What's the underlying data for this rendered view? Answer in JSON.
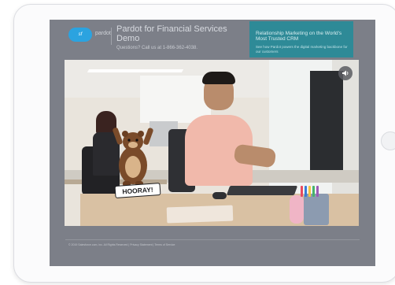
{
  "header": {
    "logo_text": "pardot",
    "title": "Pardot for Financial Services Demo",
    "subtitle": "Questions? Call us at 1-866-362-4038."
  },
  "promo": {
    "title": "Relationship Marketing on the World's Most Trusted CRM",
    "body": "See how Pardot powers the digital marketing backbone for our customers"
  },
  "video": {
    "sticker_text": "HOORAY!",
    "sound_icon": "speaker-icon"
  },
  "footer": {
    "text": "© 2019 Salesforce.com, inc. All Rights Reserved | Privacy Statement | Terms of Service"
  },
  "colors": {
    "screen_bg": "#7c7f88",
    "promo_bg": "#2e8a97",
    "logo_blue": "#2ba3e0",
    "shirt_pink": "#f1b9ab"
  }
}
